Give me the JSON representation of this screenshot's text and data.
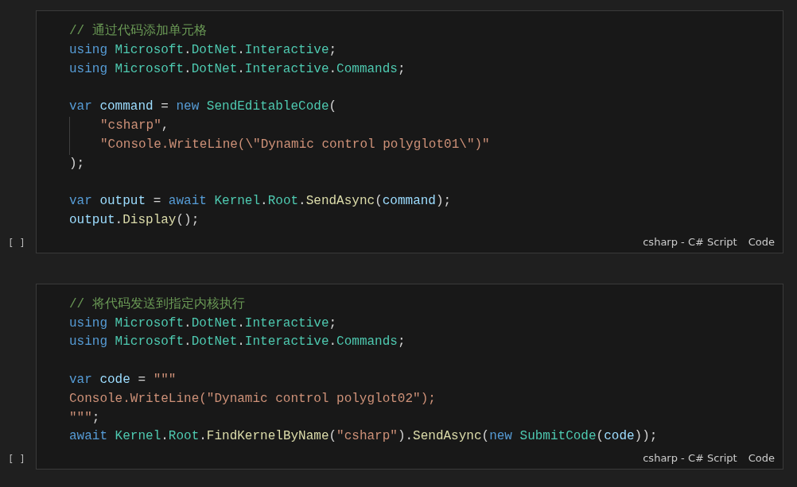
{
  "cells": [
    {
      "execution": "[ ]",
      "language": "csharp - C# Script",
      "mode": "Code",
      "lines": [
        {
          "kind": "code",
          "guide": false,
          "tokens": [
            {
              "text": "// 通过代码添加单元格",
              "kind": "comment"
            }
          ]
        },
        {
          "kind": "code",
          "guide": false,
          "tokens": [
            {
              "text": "using",
              "kind": "keyword"
            },
            {
              "text": " Microsoft",
              "kind": "type"
            },
            {
              "text": ".",
              "kind": "plain"
            },
            {
              "text": "DotNet",
              "kind": "type"
            },
            {
              "text": ".",
              "kind": "plain"
            },
            {
              "text": "Interactive",
              "kind": "type"
            },
            {
              "text": ";",
              "kind": "plain"
            }
          ]
        },
        {
          "kind": "code",
          "guide": false,
          "tokens": [
            {
              "text": "using",
              "kind": "keyword"
            },
            {
              "text": " Microsoft",
              "kind": "type"
            },
            {
              "text": ".",
              "kind": "plain"
            },
            {
              "text": "DotNet",
              "kind": "type"
            },
            {
              "text": ".",
              "kind": "plain"
            },
            {
              "text": "Interactive",
              "kind": "type"
            },
            {
              "text": ".",
              "kind": "plain"
            },
            {
              "text": "Commands",
              "kind": "type"
            },
            {
              "text": ";",
              "kind": "plain"
            }
          ]
        },
        {
          "kind": "blank"
        },
        {
          "kind": "code",
          "guide": false,
          "tokens": [
            {
              "text": "var",
              "kind": "keyword"
            },
            {
              "text": " command",
              "kind": "variable"
            },
            {
              "text": " = ",
              "kind": "plain"
            },
            {
              "text": "new",
              "kind": "keyword"
            },
            {
              "text": " SendEditableCode",
              "kind": "type"
            },
            {
              "text": "(",
              "kind": "plain"
            }
          ]
        },
        {
          "kind": "code",
          "guide": true,
          "tokens": [
            {
              "text": "\"csharp\"",
              "kind": "string"
            },
            {
              "text": ",",
              "kind": "plain"
            }
          ]
        },
        {
          "kind": "code",
          "guide": true,
          "tokens": [
            {
              "text": "\"Console.WriteLine(\\\"Dynamic control polyglot01\\\")\"",
              "kind": "string"
            }
          ]
        },
        {
          "kind": "code",
          "guide": false,
          "tokens": [
            {
              "text": ");",
              "kind": "plain"
            }
          ]
        },
        {
          "kind": "blank"
        },
        {
          "kind": "code",
          "guide": false,
          "tokens": [
            {
              "text": "var",
              "kind": "keyword"
            },
            {
              "text": " output",
              "kind": "variable"
            },
            {
              "text": " = ",
              "kind": "plain"
            },
            {
              "text": "await",
              "kind": "keyword"
            },
            {
              "text": " Kernel",
              "kind": "type"
            },
            {
              "text": ".",
              "kind": "plain"
            },
            {
              "text": "Root",
              "kind": "type"
            },
            {
              "text": ".",
              "kind": "plain"
            },
            {
              "text": "SendAsync",
              "kind": "function"
            },
            {
              "text": "(",
              "kind": "plain"
            },
            {
              "text": "command",
              "kind": "variable"
            },
            {
              "text": ");",
              "kind": "plain"
            }
          ]
        },
        {
          "kind": "code",
          "guide": false,
          "tokens": [
            {
              "text": "output",
              "kind": "variable"
            },
            {
              "text": ".",
              "kind": "plain"
            },
            {
              "text": "Display",
              "kind": "function"
            },
            {
              "text": "();",
              "kind": "plain"
            }
          ]
        }
      ]
    },
    {
      "execution": "[ ]",
      "language": "csharp - C# Script",
      "mode": "Code",
      "lines": [
        {
          "kind": "code",
          "guide": false,
          "tokens": [
            {
              "text": "// 将代码发送到指定内核执行",
              "kind": "comment"
            }
          ]
        },
        {
          "kind": "code",
          "guide": false,
          "tokens": [
            {
              "text": "using",
              "kind": "keyword"
            },
            {
              "text": " Microsoft",
              "kind": "type"
            },
            {
              "text": ".",
              "kind": "plain"
            },
            {
              "text": "DotNet",
              "kind": "type"
            },
            {
              "text": ".",
              "kind": "plain"
            },
            {
              "text": "Interactive",
              "kind": "type"
            },
            {
              "text": ";",
              "kind": "plain"
            }
          ]
        },
        {
          "kind": "code",
          "guide": false,
          "tokens": [
            {
              "text": "using",
              "kind": "keyword"
            },
            {
              "text": " Microsoft",
              "kind": "type"
            },
            {
              "text": ".",
              "kind": "plain"
            },
            {
              "text": "DotNet",
              "kind": "type"
            },
            {
              "text": ".",
              "kind": "plain"
            },
            {
              "text": "Interactive",
              "kind": "type"
            },
            {
              "text": ".",
              "kind": "plain"
            },
            {
              "text": "Commands",
              "kind": "type"
            },
            {
              "text": ";",
              "kind": "plain"
            }
          ]
        },
        {
          "kind": "blank"
        },
        {
          "kind": "code",
          "guide": false,
          "tokens": [
            {
              "text": "var",
              "kind": "keyword"
            },
            {
              "text": " code",
              "kind": "variable"
            },
            {
              "text": " = ",
              "kind": "plain"
            },
            {
              "text": "\"\"\"",
              "kind": "string"
            }
          ]
        },
        {
          "kind": "code",
          "guide": false,
          "tokens": [
            {
              "text": "Console.WriteLine(\"Dynamic control polyglot02\");",
              "kind": "string"
            }
          ]
        },
        {
          "kind": "code",
          "guide": false,
          "tokens": [
            {
              "text": "\"\"\"",
              "kind": "string"
            },
            {
              "text": ";",
              "kind": "plain"
            }
          ]
        },
        {
          "kind": "code",
          "guide": false,
          "tokens": [
            {
              "text": "await",
              "kind": "keyword"
            },
            {
              "text": " Kernel",
              "kind": "type"
            },
            {
              "text": ".",
              "kind": "plain"
            },
            {
              "text": "Root",
              "kind": "type"
            },
            {
              "text": ".",
              "kind": "plain"
            },
            {
              "text": "FindKernelByName",
              "kind": "function"
            },
            {
              "text": "(",
              "kind": "plain"
            },
            {
              "text": "\"csharp\"",
              "kind": "string"
            },
            {
              "text": ").",
              "kind": "plain"
            },
            {
              "text": "SendAsync",
              "kind": "function"
            },
            {
              "text": "(",
              "kind": "plain"
            },
            {
              "text": "new",
              "kind": "keyword"
            },
            {
              "text": " SubmitCode",
              "kind": "type"
            },
            {
              "text": "(",
              "kind": "plain"
            },
            {
              "text": "code",
              "kind": "variable"
            },
            {
              "text": "));",
              "kind": "plain"
            }
          ]
        }
      ]
    }
  ]
}
